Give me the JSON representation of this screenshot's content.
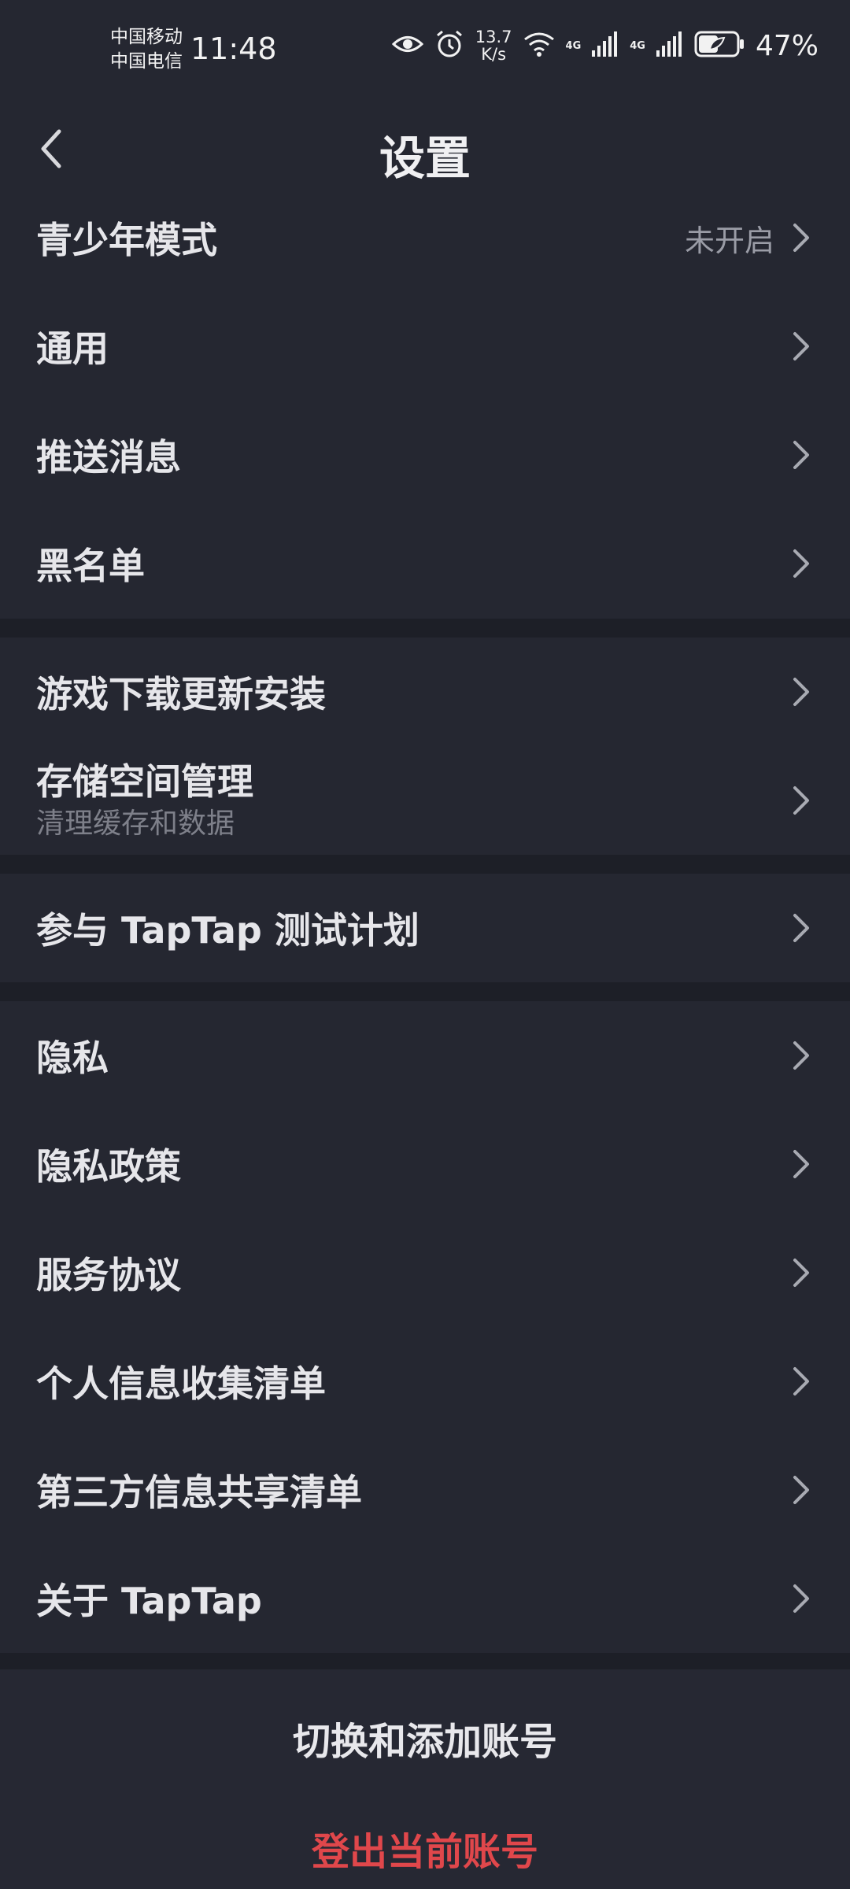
{
  "status_bar": {
    "carrier1": "中国移动",
    "carrier2": "中国电信",
    "time": "11:48",
    "speed_value": "13.7",
    "speed_unit": "K/s",
    "net1": "4G",
    "net2": "4G",
    "battery": "47%"
  },
  "header": {
    "title": "设置"
  },
  "groups": {
    "g1": [
      {
        "label": "青少年模式",
        "value": "未开启"
      },
      {
        "label": "通用"
      },
      {
        "label": "推送消息"
      },
      {
        "label": "黑名单"
      }
    ],
    "g2": [
      {
        "label": "游戏下载更新安装"
      },
      {
        "label": "存储空间管理",
        "sub": "清理缓存和数据"
      }
    ],
    "g3": [
      {
        "label": "参与 TapTap 测试计划"
      }
    ],
    "g4": [
      {
        "label": "隐私"
      },
      {
        "label": "隐私政策"
      },
      {
        "label": "服务协议"
      },
      {
        "label": "个人信息收集清单"
      },
      {
        "label": "第三方信息共享清单"
      },
      {
        "label": "关于 TapTap"
      }
    ]
  },
  "actions": {
    "switch_account": "切换和添加账号",
    "logout": "登出当前账号",
    "logout_color": "#e0474b"
  },
  "colors": {
    "background": "#252731",
    "divider": "#1d1f27"
  }
}
